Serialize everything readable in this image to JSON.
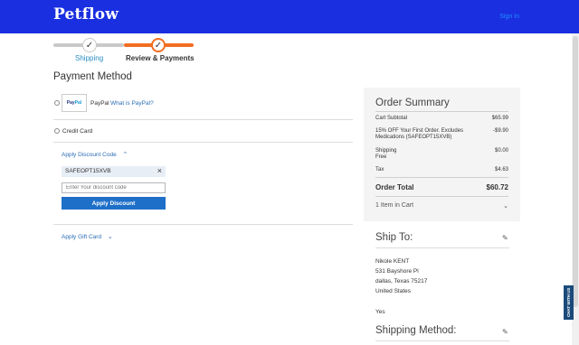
{
  "header": {
    "logo": "Petflow",
    "signin": "Sign In"
  },
  "progress": {
    "steps": [
      {
        "label": "Shipping",
        "state": "complete"
      },
      {
        "label": "Review & Payments",
        "state": "active"
      }
    ]
  },
  "payment": {
    "title": "Payment Method",
    "paypal_logo_text_1": "Pay",
    "paypal_logo_text_2": "Pal",
    "paypal_label": "PayPal",
    "paypal_link": "What is PayPal?",
    "credit_card_label": "Credit Card",
    "discount_toggle": "Apply Discount Code",
    "applied_code": "SAFEOPT15XVB",
    "discount_placeholder": "Enter Your discount code",
    "apply_button": "Apply Discount",
    "gift_card_toggle": "Apply Gift Card"
  },
  "summary": {
    "title": "Order Summary",
    "rows": [
      {
        "label": "Cart Subtotal",
        "sub": "",
        "value": "$65.99"
      },
      {
        "label": "15% OFF Your First Order. Excludes",
        "sub": "Medications (SAFEOPT15XVB)",
        "value": "-$9.90"
      },
      {
        "label": "Shipping",
        "sub": "Free",
        "value": "$0.00"
      },
      {
        "label": "Tax",
        "sub": "",
        "value": "$4.63"
      }
    ],
    "total_label": "Order Total",
    "total_value": "$60.72",
    "items_in_cart": "1 Item in Cart"
  },
  "ship_to": {
    "title": "Ship To:",
    "lines": [
      "Nikole KENT",
      "531 Bayshore Pl",
      "dallas, Texas 75217",
      "United States"
    ],
    "extra": "Yes"
  },
  "shipping_method": {
    "title": "Shipping Method:"
  },
  "side_tab": {
    "label": "CHAT WITH US"
  },
  "colors": {
    "header": "#1a2fe0",
    "accent": "#f26d21",
    "button": "#1e6fc8"
  }
}
